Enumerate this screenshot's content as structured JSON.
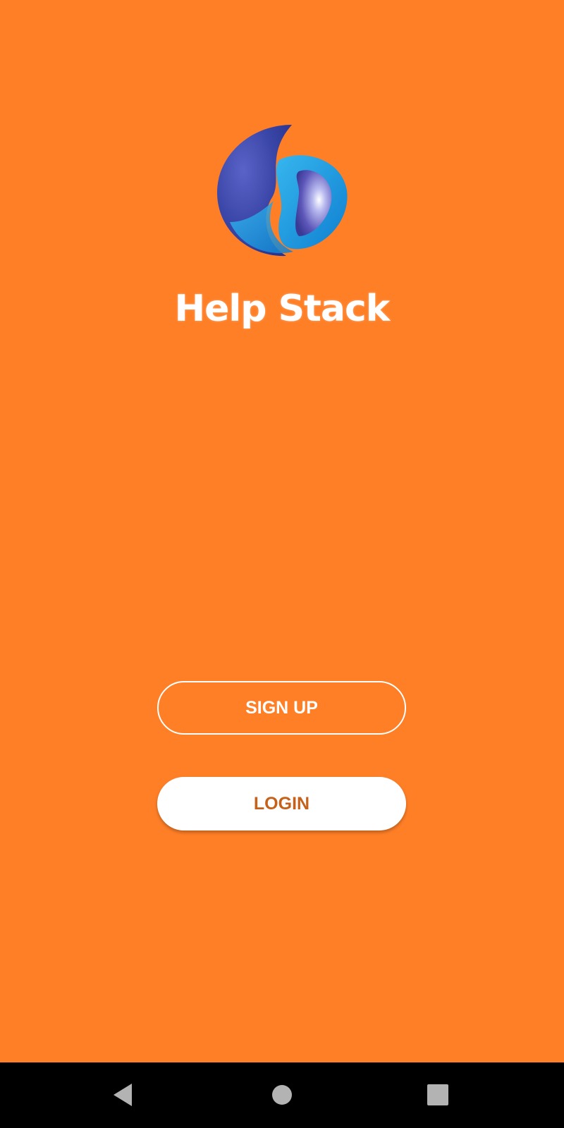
{
  "colors": {
    "background": "#ff7f27",
    "button_text_accent": "#c5611b",
    "button_fill": "#ffffff",
    "nav_bar": "#000000"
  },
  "app": {
    "logo_icon": "help-stack-logo",
    "title": "Help Stack"
  },
  "actions": {
    "signup_label": "SIGN UP",
    "login_label": "LOGIN"
  },
  "nav": {
    "back_icon": "back-triangle",
    "home_icon": "home-circle",
    "recents_icon": "recents-square"
  }
}
